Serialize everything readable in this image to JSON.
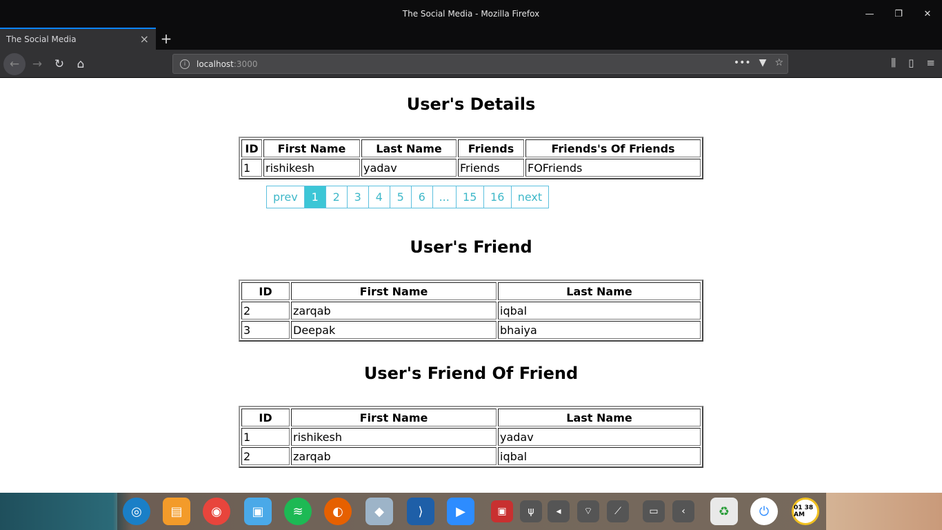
{
  "window": {
    "title": "The Social Media - Mozilla Firefox"
  },
  "browser": {
    "tab_title": "The Social Media",
    "url_host": "localhost",
    "url_port": ":3000"
  },
  "user_details": {
    "heading": "User's Details",
    "headers": [
      "ID",
      "First Name",
      "Last Name",
      "Friends",
      "Friends's Of Friends"
    ],
    "row": [
      "1",
      "rishikesh",
      "yadav",
      "Friends",
      "FOFriends"
    ]
  },
  "pagination": {
    "prev": "prev",
    "pages": [
      "1",
      "2",
      "3",
      "4",
      "5",
      "6",
      "...",
      "15",
      "16"
    ],
    "active": "1",
    "next": "next"
  },
  "friends": {
    "heading": "User's Friend",
    "headers": [
      "ID",
      "First Name",
      "Last Name"
    ],
    "rows": [
      [
        "2",
        "zarqab",
        "iqbal"
      ],
      [
        "3",
        "Deepak",
        "bhaiya"
      ]
    ]
  },
  "fof": {
    "heading": "User's Friend Of Friend",
    "headers": [
      "ID",
      "First Name",
      "Last Name"
    ],
    "rows": [
      [
        "1",
        "rishikesh",
        "yadav"
      ],
      [
        "2",
        "zarqab",
        "iqbal"
      ]
    ]
  },
  "taskbar": {
    "clock": "01 38 AM",
    "apps": [
      "deepin-launcher-icon",
      "app-store-icon",
      "chrome-icon",
      "file-manager-icon",
      "spotify-icon",
      "firefox-icon",
      "cube-icon",
      "vscode-icon",
      "zoom-icon"
    ],
    "system": [
      "screen-record-icon",
      "usb-icon",
      "volume-icon",
      "wifi-icon",
      "compass-icon",
      "battery-icon",
      "collapse-icon",
      "trash-icon",
      "power-icon",
      "clock-icon"
    ]
  }
}
